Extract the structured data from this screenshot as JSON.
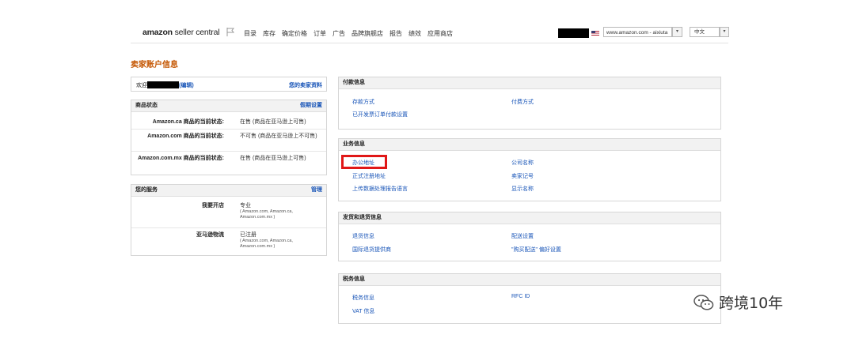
{
  "header": {
    "logo_brand": "amazon",
    "logo_suffix": " seller central",
    "nav": [
      "目录",
      "库存",
      "确定价格",
      "订单",
      "广告",
      "品牌旗舰店",
      "报告",
      "绩效",
      "应用商店"
    ],
    "marketplace": "www.amazon.com - aixiuta",
    "language": "中文"
  },
  "page_title": "卖家账户信息",
  "welcome": {
    "prefix": "欢迎",
    "edit": "(编辑)",
    "profile_link": "您的卖家资料"
  },
  "listing_status": {
    "title": "商品状态",
    "action": "假期设置",
    "rows": [
      {
        "label": "Amazon.ca 商品的当前状态:",
        "value": "在售 (商品在亚马逊上可售)"
      },
      {
        "label": "Amazon.com 商品的当前状态:",
        "value": "不可售 (商品在亚马逊上不可售)"
      },
      {
        "label": "Amazon.com.mx 商品的当前状态:",
        "value": "在售 (商品在亚马逊上可售)"
      }
    ]
  },
  "services": {
    "title": "您的服务",
    "action": "管理",
    "rows": [
      {
        "label": "我要开店",
        "value": "专业",
        "detail": "( Amazon.com, Amazon.ca, Amazon.com.mx )"
      },
      {
        "label": "亚马逊物流",
        "value": "已注册",
        "detail": "( Amazon.com, Amazon.ca, Amazon.com.mx )"
      }
    ]
  },
  "payment": {
    "title": "付款信息",
    "left": [
      "存款方式",
      "已开发票订单付款设置"
    ],
    "right": [
      "付费方式"
    ]
  },
  "business": {
    "title": "业务信息",
    "left": [
      "办公地址",
      "正式注册地址",
      "上传数据处理报告语言"
    ],
    "right": [
      "公司名称",
      "卖家记号",
      "显示名称"
    ]
  },
  "shipping": {
    "title": "发货和退货信息",
    "left": [
      "退货信息",
      "国际退货提供商"
    ],
    "right": [
      "配送设置",
      "\"购买配送\" 偏好设置"
    ]
  },
  "tax": {
    "title": "税务信息",
    "left": [
      "税务信息",
      "VAT 信息"
    ],
    "right": [
      "RFC ID"
    ]
  },
  "watermark": "跨境10年",
  "colors": {
    "accent": "#c45500",
    "link": "#1a56b8",
    "highlight": "#e01717"
  }
}
